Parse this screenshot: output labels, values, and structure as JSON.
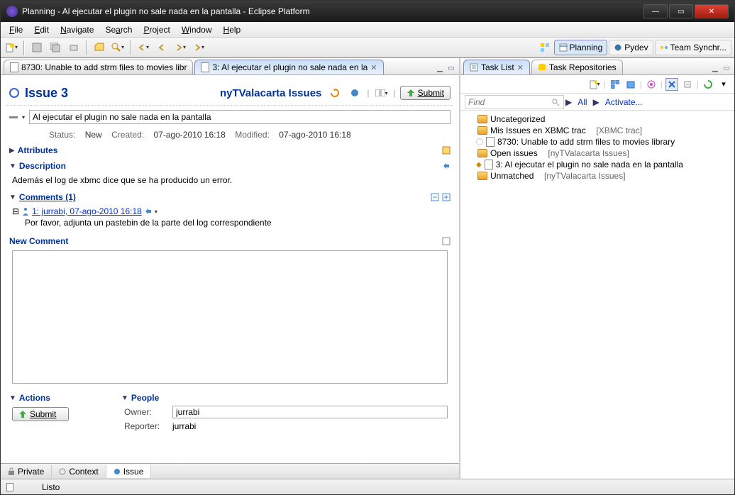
{
  "window": {
    "title": "Planning - Al ejecutar el plugin no sale nada en la pantalla - Eclipse Platform"
  },
  "menu": [
    "File",
    "Edit",
    "Navigate",
    "Search",
    "Project",
    "Window",
    "Help"
  ],
  "perspectives": [
    {
      "label": "Planning",
      "active": true
    },
    {
      "label": "Pydev",
      "active": false
    },
    {
      "label": "Team Synchr...",
      "active": false
    }
  ],
  "editorTabs": [
    {
      "label": "8730: Unable to add strm files to movies libr",
      "active": false
    },
    {
      "label": "3: Al ejecutar el plugin no sale nada en la",
      "active": true
    }
  ],
  "issue": {
    "heading": "Issue 3",
    "repo": "nyTValacarta Issues",
    "submit": "Submit",
    "summary": "Al ejecutar el plugin no sale nada en la pantalla",
    "statusLabel": "Status:",
    "status": "New",
    "createdLabel": "Created:",
    "created": "07-ago-2010 16:18",
    "modifiedLabel": "Modified:",
    "modified": "07-ago-2010 16:18"
  },
  "sections": {
    "attributes": "Attributes",
    "description": "Description",
    "descriptionText": "Además el log de xbmc dice que se ha producido un error.",
    "comments": "Comments (1)",
    "comment1Header": "1: jurrabi, 07-ago-2010 16:18",
    "comment1Text": "Por favor, adjunta un pastebin de la parte del log correspondiente",
    "newComment": "New Comment",
    "actions": "Actions",
    "actionsSubmit": "Submit",
    "people": "People",
    "ownerLabel": "Owner:",
    "owner": "jurrabi",
    "reporterLabel": "Reporter:",
    "reporter": "jurrabi"
  },
  "editorBottomTabs": [
    "Private",
    "Context",
    "Issue"
  ],
  "rightTabs": [
    "Task List",
    "Task Repositories"
  ],
  "find": {
    "placeholder": "Find",
    "all": "All",
    "activate": "Activate..."
  },
  "tree": [
    {
      "label": "Uncategorized",
      "type": "query",
      "level": 0
    },
    {
      "label": "Mis Issues en XBMC trac",
      "suffix": "[XBMC trac]",
      "type": "query",
      "level": 0
    },
    {
      "label": "8730: Unable to add strm files to movies library",
      "type": "task",
      "level": 1
    },
    {
      "label": "Open issues",
      "suffix": "[nyTValacarta Issues]",
      "type": "query",
      "level": 0
    },
    {
      "label": "3: Al ejecutar el plugin no sale nada en la pantalla",
      "type": "task",
      "level": 1,
      "selected": false
    },
    {
      "label": "Unmatched",
      "suffix": "[nyTValacarta Issues]",
      "type": "query",
      "level": 0
    }
  ],
  "status": "Listo"
}
